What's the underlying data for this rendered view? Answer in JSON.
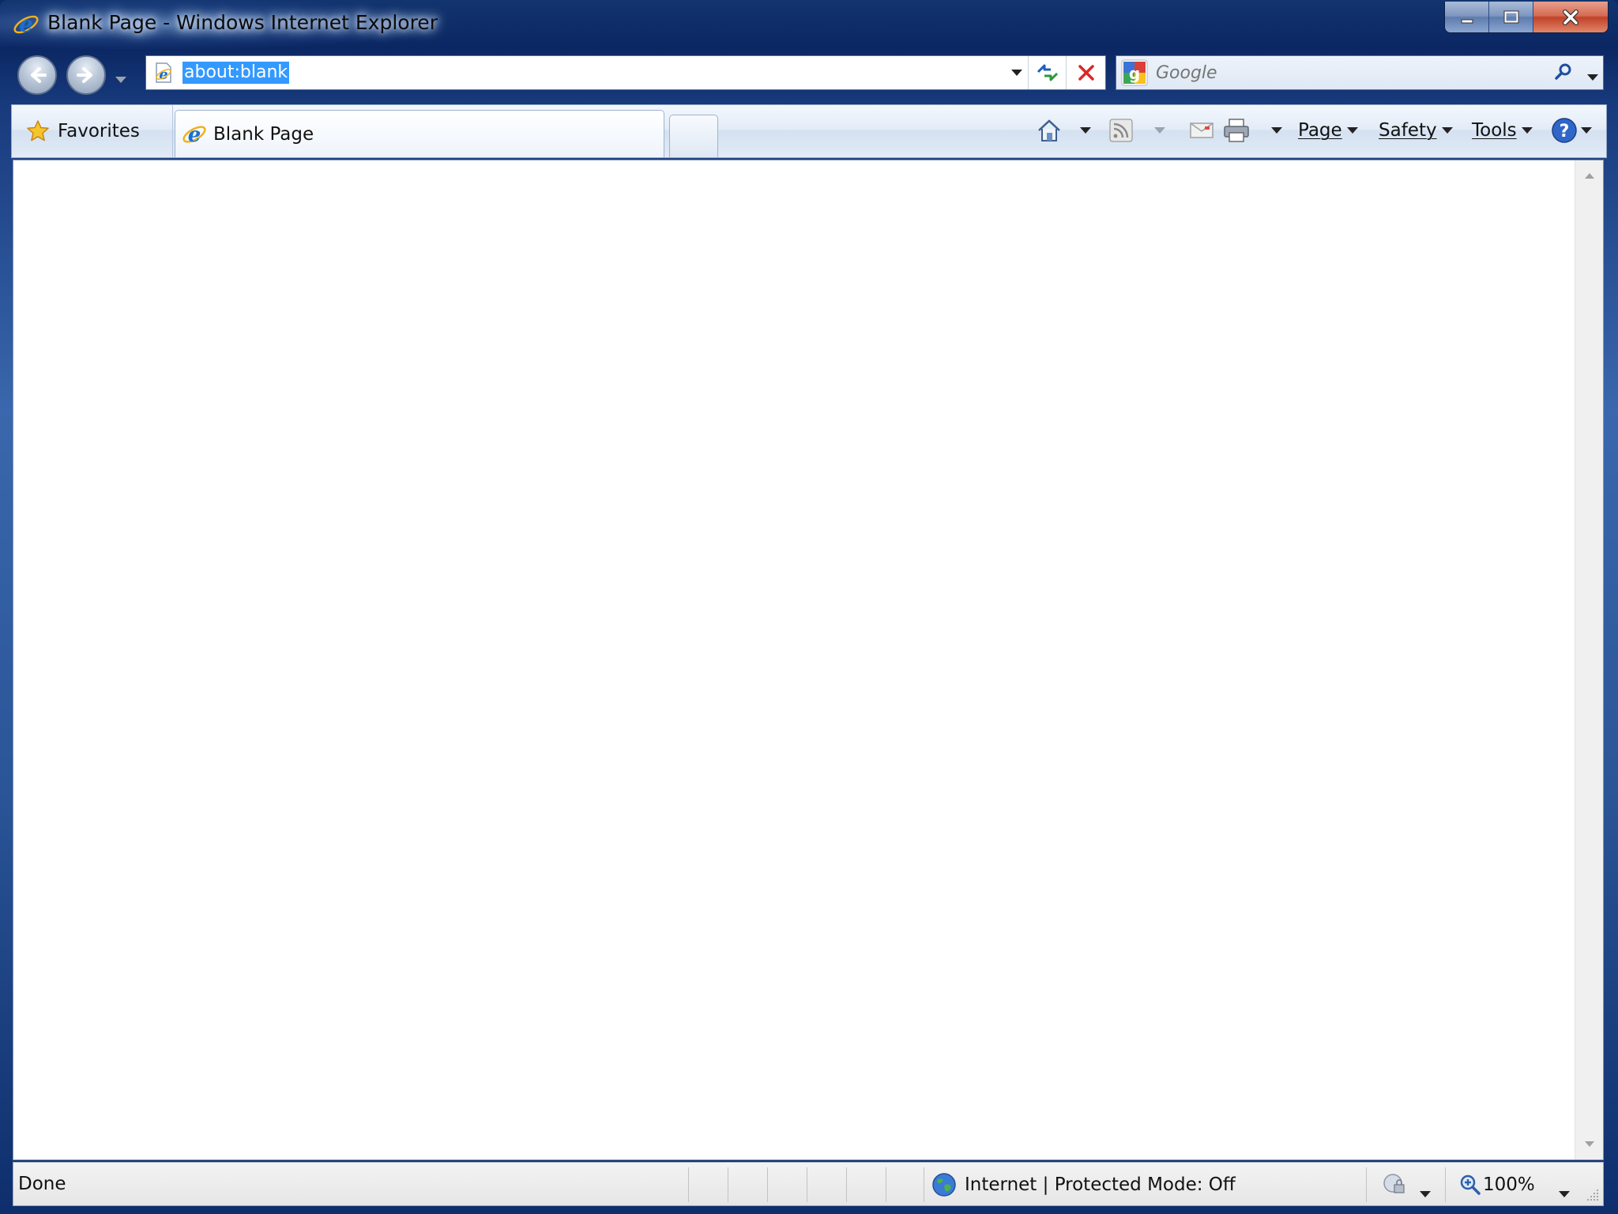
{
  "window": {
    "title": "Blank Page - Windows Internet Explorer"
  },
  "navigation": {
    "address": "about:blank",
    "search_placeholder": "Google"
  },
  "command_bar": {
    "favorites_label": "Favorites",
    "tab_title": "Blank Page",
    "page_menu": "Page",
    "safety_menu": "Safety",
    "tools_menu": "Tools"
  },
  "status_bar": {
    "status_text": "Done",
    "zone_text": "Internet | Protected Mode: Off",
    "zoom_level": "100%"
  },
  "icons": {
    "title_icon": "ie-icon",
    "back": "back-arrow-icon",
    "forward": "forward-arrow-icon",
    "refresh": "refresh-icon",
    "stop": "stop-x-icon",
    "search_provider": "google-icon",
    "search_go": "magnifier-icon",
    "favorites": "star-icon",
    "home": "home-icon",
    "feeds": "rss-feed-icon",
    "mail": "mail-icon",
    "print": "printer-icon",
    "help": "help-icon",
    "zone": "globe-icon",
    "zoom": "magnifier-plus-icon"
  },
  "colors": {
    "frame": "#1b3f80",
    "selection": "#3399ff",
    "close_button": "#c9462c",
    "ie_blue": "#1a6fd1"
  }
}
